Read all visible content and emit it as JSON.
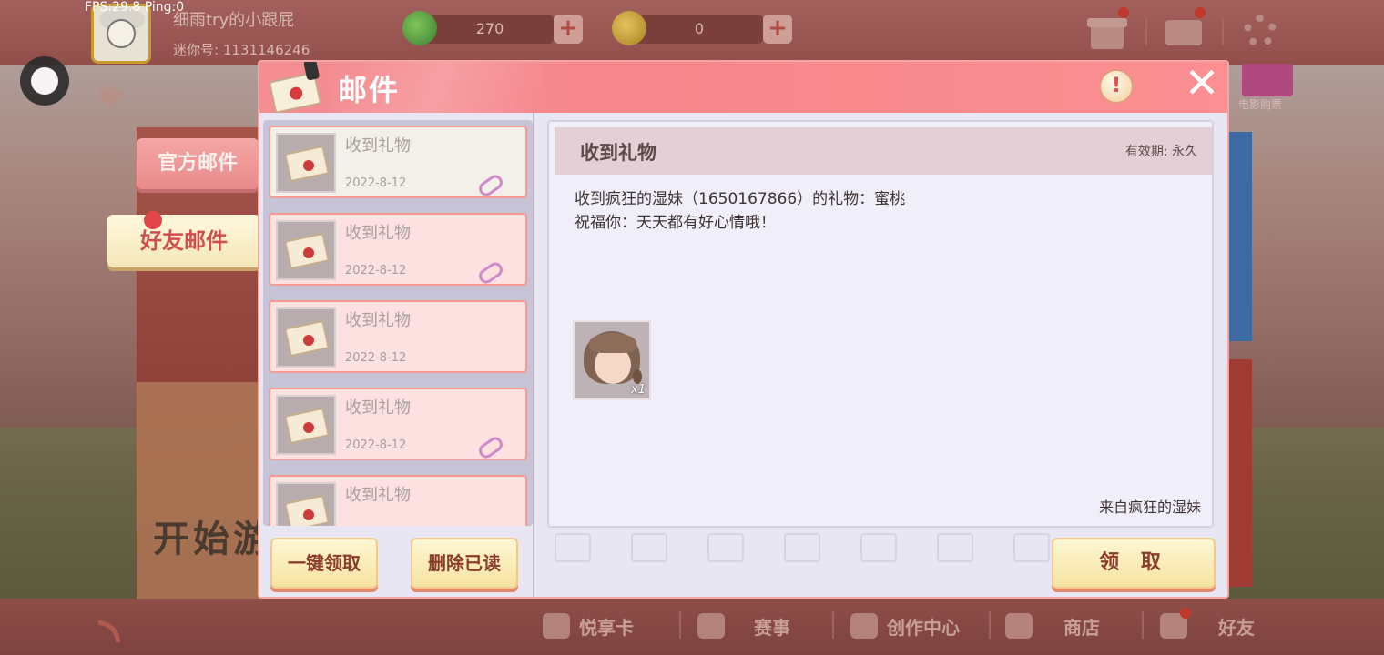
{
  "overlay": {
    "fps_text": "FPS:29.8  Ping:0"
  },
  "profile": {
    "username": "细雨try的小跟屁",
    "mini_id": "迷你号: 1131146246"
  },
  "currency": {
    "green_value": "270",
    "gold_value": "0",
    "plus_label": "+"
  },
  "side_tabs": {
    "official": "官方邮件",
    "friend": "好友邮件"
  },
  "dialog": {
    "title": "邮件",
    "info_label": "!",
    "close_label": "✕"
  },
  "mail_list": [
    {
      "subject": "收到礼物",
      "date": "2022-8-12",
      "state": "read"
    },
    {
      "subject": "收到礼物",
      "date": "2022-8-12",
      "state": "unread"
    },
    {
      "subject": "收到礼物",
      "date": "2022-8-12",
      "state": "unread"
    },
    {
      "subject": "收到礼物",
      "date": "2022-8-12",
      "state": "unread"
    },
    {
      "subject": "收到礼物",
      "date": "",
      "state": "unread"
    }
  ],
  "list_buttons": {
    "claim_all": "一键领取",
    "delete_read": "删除已读"
  },
  "detail": {
    "subject": "收到礼物",
    "expire": "有效期: 永久",
    "body_line1": "收到疯狂的湿妹（1650167866）的礼物：蜜桃",
    "body_line2": "祝福你：天天都有好心情哦！",
    "reward_count": "x1",
    "from": "来自疯狂的湿妹"
  },
  "claim_button": "领 取",
  "background": {
    "start_text": "开始游",
    "movie_ticket": "电影购票"
  },
  "bottom_nav": {
    "items": [
      "悦享卡",
      "赛事",
      "创作中心",
      "商店",
      "好友"
    ]
  },
  "colors": {
    "header_pink": "#f6878c",
    "unread_bg": "#fde0e0",
    "read_bg": "#f2f0e8",
    "button_yellow": "#f6e3a1",
    "badge_red": "#e2464b"
  },
  "icons": [
    "gift-icon",
    "mail-icon",
    "gear-icon",
    "megaphone-icon",
    "envelope-icon",
    "attachment-icon",
    "info-icon",
    "close-icon",
    "wifi-icon",
    "record-icon"
  ]
}
